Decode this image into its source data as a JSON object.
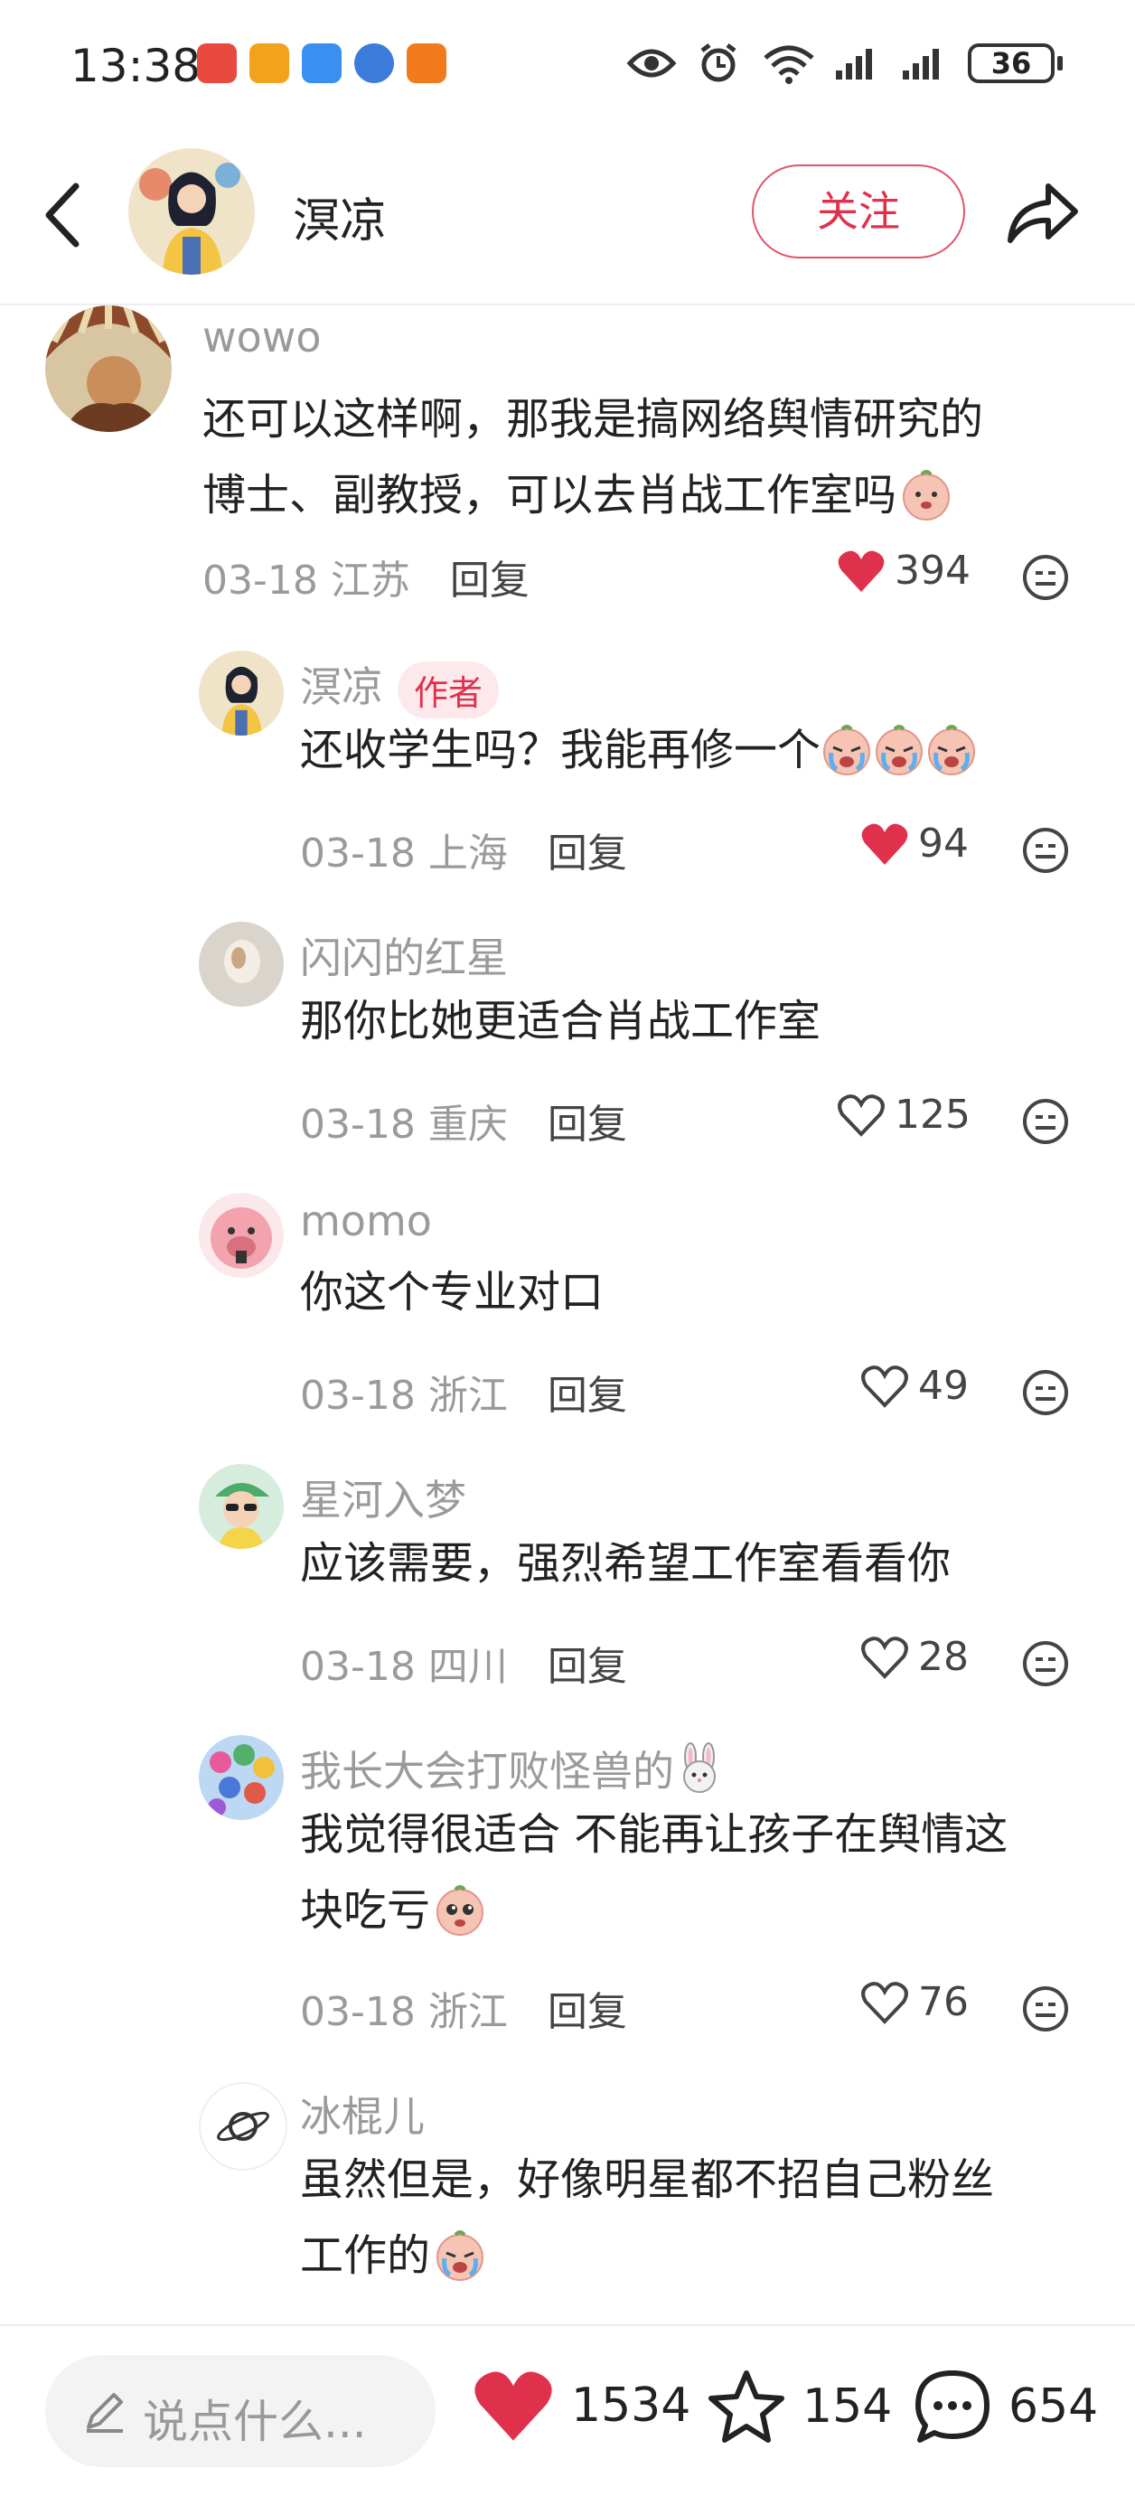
{
  "status_bar": {
    "time": "13:38",
    "battery": "36",
    "app_icons": [
      "#e94a3f",
      "#f2a21c",
      "#3a8ff0",
      "#3b7bd9",
      "#f07a1c"
    ]
  },
  "header": {
    "title": "溟凉",
    "follow_label": "关注",
    "accent": "#e0314c"
  },
  "comments": [
    {
      "id": "c1",
      "user": "wowo",
      "text_lines": [
        "还可以这样啊，那我是搞网络舆情研究的",
        "博士、副教授，可以去肖战工作室吗"
      ],
      "date": "03-18",
      "region": "江苏",
      "reply_label": "回复",
      "likes": "394",
      "liked": true,
      "emoji": [
        "face-emoji"
      ]
    },
    {
      "id": "c2",
      "user": "溟凉",
      "author_tag": "作者",
      "text_lines": [
        "还收学生吗？我能再修一个"
      ],
      "date": "03-18",
      "region": "上海",
      "reply_label": "回复",
      "likes": "94",
      "liked": true,
      "emoji": [
        "crying-emoji",
        "crying-emoji",
        "crying-emoji"
      ]
    },
    {
      "id": "c3",
      "user": "闪闪的红星",
      "text_lines": [
        "那你比她更适合肖战工作室"
      ],
      "date": "03-18",
      "region": "重庆",
      "reply_label": "回复",
      "likes": "125",
      "liked": false
    },
    {
      "id": "c4",
      "user": "momo",
      "text_lines": [
        "你这个专业对口"
      ],
      "date": "03-18",
      "region": "浙江",
      "reply_label": "回复",
      "likes": "49",
      "liked": false
    },
    {
      "id": "c5",
      "user": "星河入梦",
      "text_lines": [
        "应该需要，强烈希望工作室看看你"
      ],
      "date": "03-18",
      "region": "四川",
      "reply_label": "回复",
      "likes": "28",
      "liked": false
    },
    {
      "id": "c6",
      "user": "我长大会打败怪兽的",
      "text_lines": [
        "我觉得很适合 不能再让孩子在舆情这",
        "块吃亏"
      ],
      "date": "03-18",
      "region": "浙江",
      "reply_label": "回复",
      "likes": "76",
      "liked": false,
      "emoji": [
        "rabbit-emoji",
        "pleading-emoji"
      ]
    },
    {
      "id": "c7",
      "user": "冰棍儿",
      "text_lines": [
        "虽然但是，好像明星都不招自己粉丝",
        "工作的"
      ],
      "emoji": [
        "crying-emoji"
      ]
    }
  ],
  "bottom_bar": {
    "input_placeholder": "说点什么...",
    "likes": "1534",
    "favorites": "154",
    "comments": "654"
  }
}
